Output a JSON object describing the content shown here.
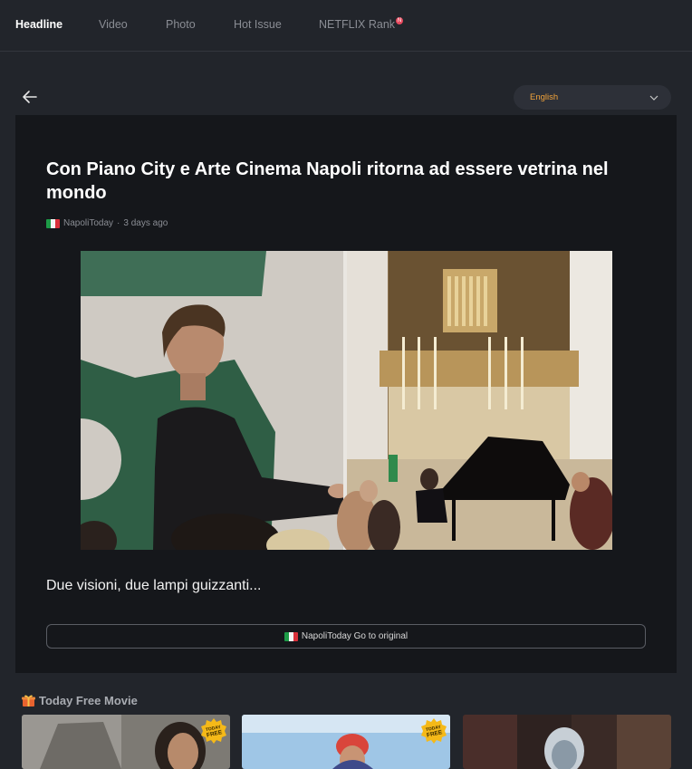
{
  "nav": {
    "items": [
      {
        "label": "Headline"
      },
      {
        "label": "Video"
      },
      {
        "label": "Photo"
      },
      {
        "label": "Hot Issue"
      },
      {
        "label": "NETFLIX Rank"
      }
    ],
    "active_index": 0,
    "rank_badge": "N"
  },
  "language": {
    "selected": "English"
  },
  "article": {
    "title": "Con Piano City e Arte Cinema Napoli ritorna ad essere vetrina nel mondo",
    "source": "NapoliToday",
    "time_ago": "3 days ago",
    "summary": "Due visioni, due lampi guizzanti...",
    "original_button": "NapoliToday Go to original"
  },
  "free_movies": {
    "heading": "Today Free Movie",
    "badge_line1": "TODAY",
    "badge_line2": "FREE"
  },
  "colors": {
    "accent": "#f0a23a",
    "background": "#22252b",
    "card": "#15171b"
  }
}
